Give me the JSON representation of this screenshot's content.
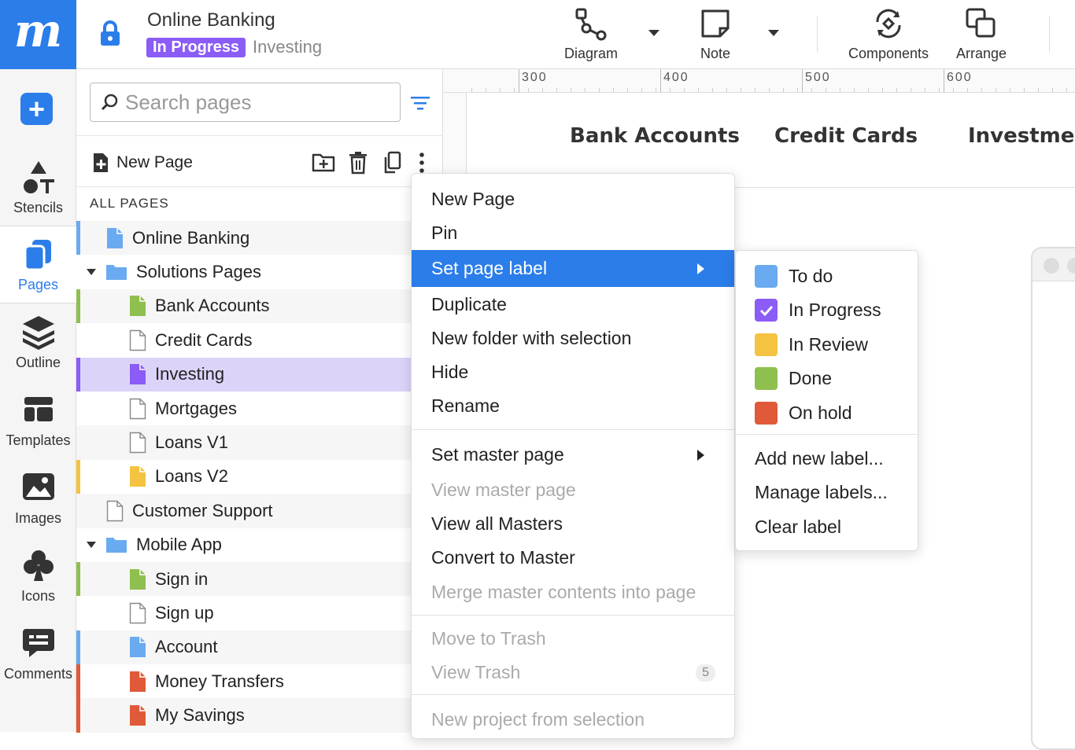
{
  "app": {
    "logo_text": "m"
  },
  "rail": {
    "items": [
      {
        "label": "Stencils",
        "icon": "stencils-icon"
      },
      {
        "label": "Pages",
        "icon": "pages-icon"
      },
      {
        "label": "Outline",
        "icon": "layers-icon"
      },
      {
        "label": "Templates",
        "icon": "templates-icon"
      },
      {
        "label": "Images",
        "icon": "image-icon"
      },
      {
        "label": "Icons",
        "icon": "club-icon"
      },
      {
        "label": "Comments",
        "icon": "comment-icon"
      }
    ]
  },
  "header": {
    "project_title": "Online Banking",
    "status_badge": "In Progress",
    "current_page": "Investing",
    "tools": [
      {
        "label": "Diagram",
        "icon": "diagram-icon"
      },
      {
        "label": "Note",
        "icon": "note-icon"
      },
      {
        "label": "Components",
        "icon": "components-icon"
      },
      {
        "label": "Arrange",
        "icon": "arrange-icon"
      }
    ]
  },
  "pages_panel": {
    "search_placeholder": "Search pages",
    "new_page_label": "New Page",
    "section_label": "ALL PAGES",
    "tree": [
      {
        "label": "Online Banking",
        "type": "page",
        "color": "#6aaaf0",
        "bar": "#6aaaf0"
      },
      {
        "label": "Solutions Pages",
        "type": "folder",
        "expanded": true
      },
      {
        "label": "Bank Accounts",
        "type": "page",
        "color": "#8fbf4f",
        "bar": "#8fbf4f"
      },
      {
        "label": "Credit Cards",
        "type": "page",
        "color": "",
        "bar": ""
      },
      {
        "label": "Investing",
        "type": "page",
        "color": "#8b5cf6",
        "bar": "#8b5cf6",
        "selected": true
      },
      {
        "label": "Mortgages",
        "type": "page",
        "color": "",
        "bar": ""
      },
      {
        "label": "Loans V1",
        "type": "page",
        "color": "",
        "bar": ""
      },
      {
        "label": "Loans V2",
        "type": "page",
        "color": "#f5c342",
        "bar": "#f5c342"
      },
      {
        "label": "Customer Support",
        "type": "page",
        "color": "",
        "bar": ""
      },
      {
        "label": "Mobile App",
        "type": "folder",
        "expanded": true
      },
      {
        "label": "Sign in",
        "type": "page",
        "color": "#8fbf4f",
        "bar": "#8fbf4f"
      },
      {
        "label": "Sign up",
        "type": "page",
        "color": "",
        "bar": ""
      },
      {
        "label": "Account",
        "type": "page",
        "color": "#6aaaf0",
        "bar": "#6aaaf0"
      },
      {
        "label": "Money Transfers",
        "type": "page",
        "color": "#e05a3a",
        "bar": "#e05a3a"
      },
      {
        "label": "My Savings",
        "type": "page",
        "color": "#e05a3a",
        "bar": "#e05a3a"
      }
    ]
  },
  "canvas": {
    "ruler_labels": [
      "300",
      "400",
      "500",
      "600"
    ],
    "nav_links": [
      "Bank Accounts",
      "Credit Cards",
      "Investment"
    ]
  },
  "context_menu": {
    "items": [
      {
        "label": "New Page"
      },
      {
        "label": "Pin"
      },
      {
        "label": "Set page label",
        "submenu": true,
        "highlighted": true
      },
      {
        "label": "Duplicate"
      },
      {
        "label": "New folder with selection"
      },
      {
        "label": "Hide"
      },
      {
        "label": "Rename"
      },
      {
        "label": "Set master page",
        "submenu": true
      },
      {
        "label": "View master page",
        "disabled": true
      },
      {
        "label": "View all Masters"
      },
      {
        "label": "Convert to Master"
      },
      {
        "label": "Merge master contents into page",
        "disabled": true
      },
      {
        "label": "Move to Trash",
        "disabled": true
      },
      {
        "label": "View Trash",
        "disabled": true,
        "count": "5"
      },
      {
        "label": "New project from selection",
        "disabled": true
      }
    ]
  },
  "label_submenu": {
    "labels": [
      {
        "label": "To do",
        "color": "#6aaaf0",
        "checked": false
      },
      {
        "label": "In Progress",
        "color": "#8b5cf6",
        "checked": true
      },
      {
        "label": "In Review",
        "color": "#f5c342",
        "checked": false
      },
      {
        "label": "Done",
        "color": "#8fbf4f",
        "checked": false
      },
      {
        "label": "On hold",
        "color": "#e05a3a",
        "checked": false
      }
    ],
    "actions": [
      "Add new label...",
      "Manage labels...",
      "Clear label"
    ]
  }
}
